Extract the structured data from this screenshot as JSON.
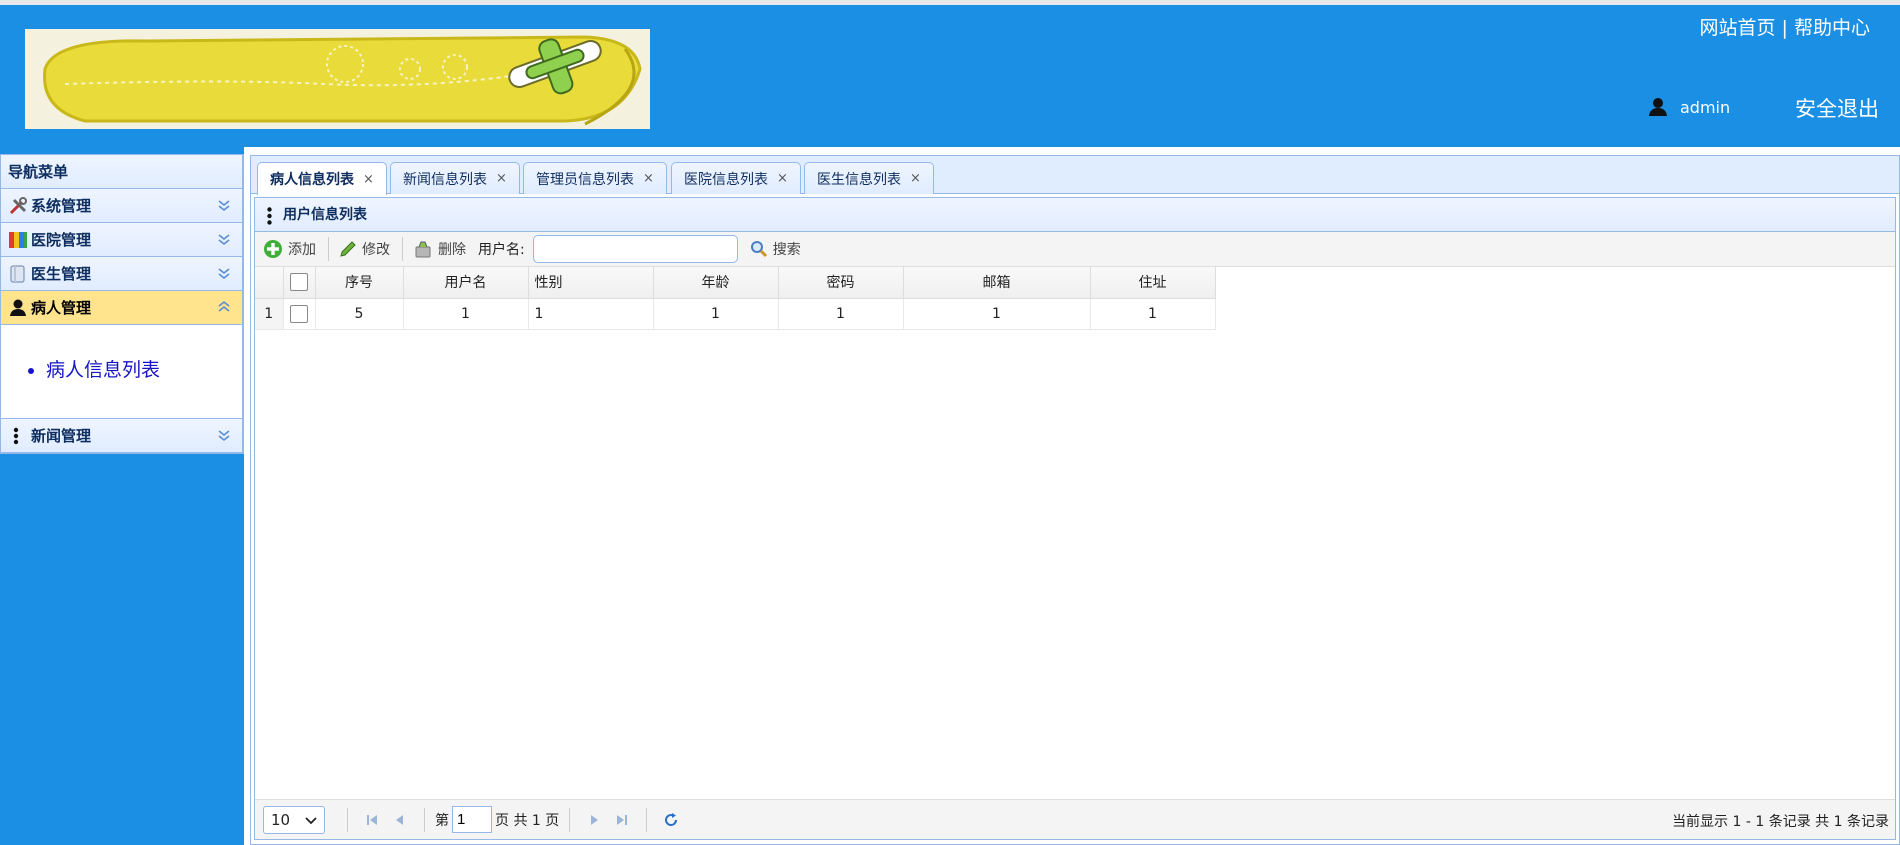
{
  "header": {
    "home_link": "网站首页",
    "link_separator": "|",
    "help_link": "帮助中心",
    "username": "admin",
    "logout": "安全退出"
  },
  "sidebar": {
    "title": "导航菜单",
    "sections": [
      {
        "label": "系统管理",
        "icon": "tools-icon"
      },
      {
        "label": "医院管理",
        "icon": "hospital-icon"
      },
      {
        "label": "医生管理",
        "icon": "doctor-icon"
      },
      {
        "label": "病人管理",
        "icon": "user-icon",
        "expanded": true,
        "items": [
          "病人信息列表"
        ]
      },
      {
        "label": "新闻管理",
        "icon": "dots-icon"
      }
    ]
  },
  "tabs": [
    {
      "label": "病人信息列表",
      "selected": true
    },
    {
      "label": "新闻信息列表"
    },
    {
      "label": "管理员信息列表"
    },
    {
      "label": "医院信息列表"
    },
    {
      "label": "医生信息列表"
    }
  ],
  "tab_close": "×",
  "panel": {
    "title": "用户信息列表"
  },
  "toolbar": {
    "add": "添加",
    "edit": "修改",
    "delete": "删除",
    "search_label": "用户名:",
    "search_value": "",
    "search": "搜索"
  },
  "grid": {
    "columns": [
      "序号",
      "用户名",
      "性别",
      "年龄",
      "密码",
      "邮箱",
      "住址"
    ],
    "rows": [
      {
        "row_number": "1",
        "cells": [
          "5",
          "1",
          "1",
          "1",
          "1",
          "1",
          "1"
        ]
      }
    ]
  },
  "pager": {
    "page_size": "10",
    "page_prefix": "第",
    "page_value": "1",
    "page_suffix": "页 共 1 页",
    "info": "当前显示 1 - 1 条记录 共 1 条记录"
  },
  "colors": {
    "header_bg": "#1a8fe4",
    "panel_border": "#95b8e7",
    "active_section": "#ffe48d"
  }
}
